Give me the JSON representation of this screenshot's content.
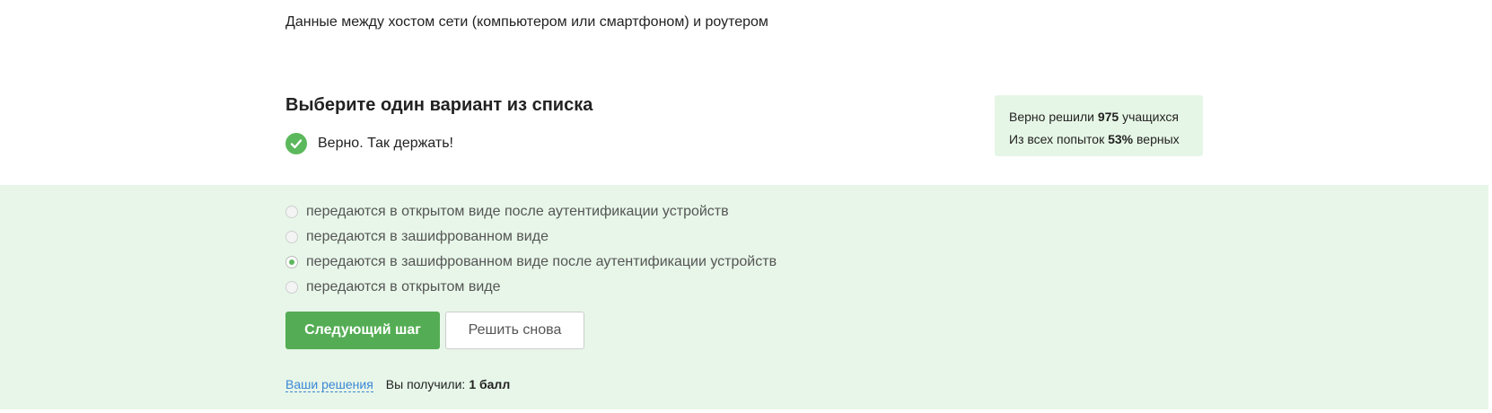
{
  "question": {
    "text": "Данные между хостом сети (компьютером или смартфоном) и роутером"
  },
  "prompt": {
    "title": "Выберите один вариант из списка"
  },
  "status": {
    "icon": "check-circle-icon",
    "text": "Верно. Так держать!",
    "color": "#5cb85c"
  },
  "stats": {
    "solved_prefix": "Верно решили",
    "solved_count": "975",
    "solved_suffix": "учащихся",
    "attempts_prefix": "Из всех попыток",
    "attempts_percent": "53%",
    "attempts_suffix": "верных"
  },
  "options": [
    {
      "label": "передаются в открытом виде после аутентификации устройств",
      "selected": false
    },
    {
      "label": "передаются в зашифрованном виде",
      "selected": false
    },
    {
      "label": "передаются в зашифрованном виде после аутентификации устройств",
      "selected": true
    },
    {
      "label": "передаются в открытом виде",
      "selected": false
    }
  ],
  "buttons": {
    "next_label": "Следующий шаг",
    "retry_label": "Решить снова"
  },
  "footer": {
    "solutions_link": "Ваши решения",
    "score_label": "Вы получили:",
    "score_value": "1 балл"
  },
  "colors": {
    "accent": "#54ad54",
    "answer_bg": "#e7f6e8",
    "stats_bg": "#e6f6e6",
    "link": "#3c87d6"
  }
}
